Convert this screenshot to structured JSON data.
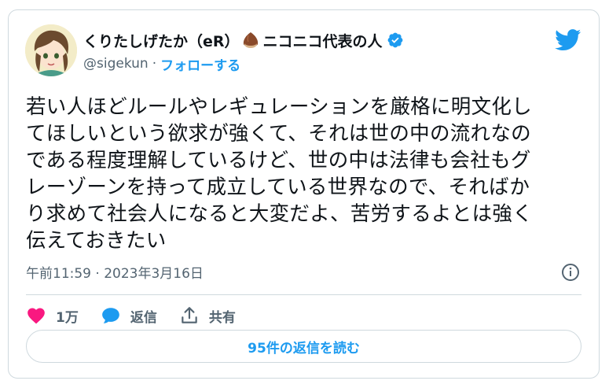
{
  "author": {
    "display_name": "くりたしげたか（eR）",
    "name_suffix": "ニコニコ代表の人",
    "handle": "@sigekun",
    "separator": "·",
    "follow_label": "フォローする",
    "avatar_icon": "anime-avatar",
    "verified_icon": "verified-badge-icon",
    "chestnut_icon": "chestnut-emoji-icon"
  },
  "tweet": {
    "lines": [
      "若い人ほどルールやレギュレーションを厳格に明文化し",
      "てほしいという欲求が強くて、それは世の中の流れなの",
      "である程度理解しているけど、世の中は法律も会社もグ",
      "レーゾーンを持って成立している世界なので、そればか",
      "り求めて社会人になると大変だよ、苦労するよとは強く",
      "伝えておきたい"
    ],
    "timestamp": "午前11:59 · 2023年3月16日"
  },
  "actions": {
    "like_count": "1万",
    "reply_label": "返信",
    "share_label": "共有"
  },
  "read_replies_label": "95件の返信を読む",
  "colors": {
    "accent": "#1d9bf0",
    "like": "#f91880",
    "text": "#0f1419",
    "muted": "#536471",
    "border": "#cfd9de"
  }
}
